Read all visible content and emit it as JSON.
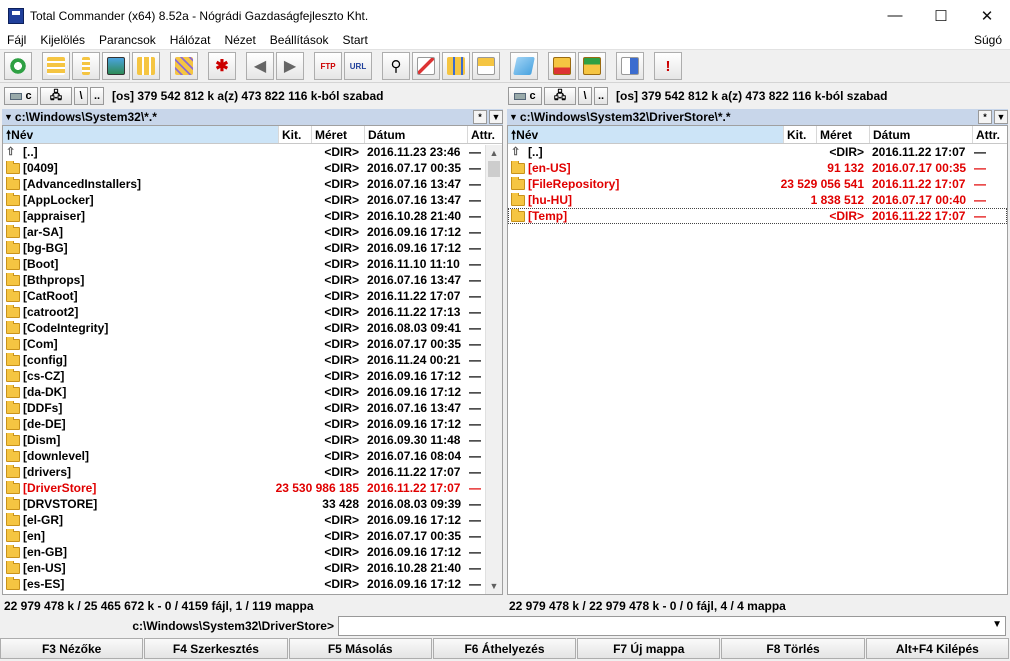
{
  "window": {
    "title": "Total Commander (x64) 8.52a - Nógrádi Gazdaságfejleszto Kht.",
    "min": "—",
    "max": "☐",
    "close": "✕"
  },
  "menu": {
    "items": [
      "Fájl",
      "Kijelölés",
      "Parancsok",
      "Hálózat",
      "Nézet",
      "Beállítások",
      "Start"
    ],
    "help": "Súgó"
  },
  "toolbar": {
    "ftp": "FTP",
    "url": "URL"
  },
  "left": {
    "drive": "c",
    "backslash": "\\",
    "dotdot": "..",
    "free": "[os]  379 542 812 k a(z) 473 822 116 k-ból szabad",
    "path": "c:\\Windows\\System32\\*.*",
    "star": "*",
    "cols": {
      "name": "Név",
      "ext": "Kit.",
      "size": "Méret",
      "date": "Dátum",
      "attr": "Attr."
    },
    "rows": [
      {
        "name": "[..]",
        "size": "<DIR>",
        "date": "2016.11.23 23:46",
        "attr": "—",
        "up": true
      },
      {
        "name": "[0409]",
        "size": "<DIR>",
        "date": "2016.07.17 00:35",
        "attr": "—"
      },
      {
        "name": "[AdvancedInstallers]",
        "size": "<DIR>",
        "date": "2016.07.16 13:47",
        "attr": "—"
      },
      {
        "name": "[AppLocker]",
        "size": "<DIR>",
        "date": "2016.07.16 13:47",
        "attr": "—"
      },
      {
        "name": "[appraiser]",
        "size": "<DIR>",
        "date": "2016.10.28 21:40",
        "attr": "—"
      },
      {
        "name": "[ar-SA]",
        "size": "<DIR>",
        "date": "2016.09.16 17:12",
        "attr": "—"
      },
      {
        "name": "[bg-BG]",
        "size": "<DIR>",
        "date": "2016.09.16 17:12",
        "attr": "—"
      },
      {
        "name": "[Boot]",
        "size": "<DIR>",
        "date": "2016.11.10 11:10",
        "attr": "—"
      },
      {
        "name": "[Bthprops]",
        "size": "<DIR>",
        "date": "2016.07.16 13:47",
        "attr": "—"
      },
      {
        "name": "[CatRoot]",
        "size": "<DIR>",
        "date": "2016.11.22 17:07",
        "attr": "—"
      },
      {
        "name": "[catroot2]",
        "size": "<DIR>",
        "date": "2016.11.22 17:13",
        "attr": "—"
      },
      {
        "name": "[CodeIntegrity]",
        "size": "<DIR>",
        "date": "2016.08.03 09:41",
        "attr": "—"
      },
      {
        "name": "[Com]",
        "size": "<DIR>",
        "date": "2016.07.17 00:35",
        "attr": "—"
      },
      {
        "name": "[config]",
        "size": "<DIR>",
        "date": "2016.11.24 00:21",
        "attr": "—"
      },
      {
        "name": "[cs-CZ]",
        "size": "<DIR>",
        "date": "2016.09.16 17:12",
        "attr": "—"
      },
      {
        "name": "[da-DK]",
        "size": "<DIR>",
        "date": "2016.09.16 17:12",
        "attr": "—"
      },
      {
        "name": "[DDFs]",
        "size": "<DIR>",
        "date": "2016.07.16 13:47",
        "attr": "—"
      },
      {
        "name": "[de-DE]",
        "size": "<DIR>",
        "date": "2016.09.16 17:12",
        "attr": "—"
      },
      {
        "name": "[Dism]",
        "size": "<DIR>",
        "date": "2016.09.30 11:48",
        "attr": "—"
      },
      {
        "name": "[downlevel]",
        "size": "<DIR>",
        "date": "2016.07.16 08:04",
        "attr": "—"
      },
      {
        "name": "[drivers]",
        "size": "<DIR>",
        "date": "2016.11.22 17:07",
        "attr": "—"
      },
      {
        "name": "[DriverStore]",
        "size": "23 530 986 185",
        "date": "2016.11.22 17:07",
        "attr": "—",
        "red": true
      },
      {
        "name": "[DRVSTORE]",
        "size": "33 428",
        "date": "2016.08.03 09:39",
        "attr": "—"
      },
      {
        "name": "[el-GR]",
        "size": "<DIR>",
        "date": "2016.09.16 17:12",
        "attr": "—"
      },
      {
        "name": "[en]",
        "size": "<DIR>",
        "date": "2016.07.17 00:35",
        "attr": "—"
      },
      {
        "name": "[en-GB]",
        "size": "<DIR>",
        "date": "2016.09.16 17:12",
        "attr": "—"
      },
      {
        "name": "[en-US]",
        "size": "<DIR>",
        "date": "2016.10.28 21:40",
        "attr": "—"
      },
      {
        "name": "[es-ES]",
        "size": "<DIR>",
        "date": "2016.09.16 17:12",
        "attr": "—"
      }
    ],
    "status": "22 979 478 k / 25 465 672 k - 0 / 4159 fájl, 1 / 119 mappa"
  },
  "right": {
    "drive": "c",
    "backslash": "\\",
    "dotdot": "..",
    "free": "[os]  379 542 812 k a(z) 473 822 116 k-ból szabad",
    "path": "c:\\Windows\\System32\\DriverStore\\*.*",
    "star": "*",
    "cols": {
      "name": "Név",
      "ext": "Kit.",
      "size": "Méret",
      "date": "Dátum",
      "attr": "Attr."
    },
    "rows": [
      {
        "name": "[..]",
        "size": "<DIR>",
        "date": "2016.11.22 17:07",
        "attr": "—",
        "up": true
      },
      {
        "name": "[en-US]",
        "size": "91 132",
        "date": "2016.07.17 00:35",
        "attr": "—",
        "red": true
      },
      {
        "name": "[FileRepository]",
        "size": "23 529 056 541",
        "date": "2016.11.22 17:07",
        "attr": "—",
        "red": true
      },
      {
        "name": "[hu-HU]",
        "size": "1 838 512",
        "date": "2016.07.17 00:40",
        "attr": "—",
        "red": true
      },
      {
        "name": "[Temp]",
        "size": "<DIR>",
        "date": "2016.11.22 17:07",
        "attr": "—",
        "red": true,
        "cursor": true
      }
    ],
    "status": "22 979 478 k / 22 979 478 k - 0 / 0 fájl, 4 / 4 mappa"
  },
  "cmd": {
    "label": "c:\\Windows\\System32\\DriverStore>",
    "value": ""
  },
  "fkeys": [
    "F3 Nézőke",
    "F4 Szerkesztés",
    "F5 Másolás",
    "F6 Áthelyezés",
    "F7 Új mappa",
    "F8 Törlés",
    "Alt+F4 Kilépés"
  ]
}
